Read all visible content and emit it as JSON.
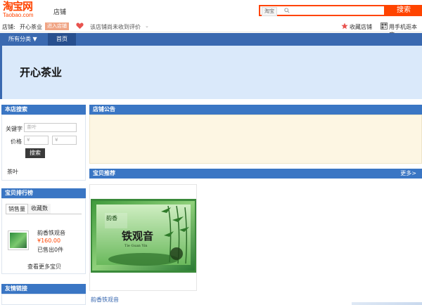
{
  "header": {
    "logo_cn": "淘宝网",
    "logo_en": "Taobao.com",
    "shop_nav": "店铺",
    "search_scope": "淘宝",
    "search_placeholder": "",
    "search_button": "搜索",
    "accent_color": "#ff4400"
  },
  "shop_info": {
    "label": "店铺:",
    "shop_name": "开心茶业",
    "enter_button": "进入店铺",
    "rating_text": "该店铺尚未收到评价",
    "rating_caret": "⌄",
    "favorite_label": "收藏店铺",
    "mobile_label": "用手机逛本店"
  },
  "nav": {
    "all_categories": "所有分类 ▼",
    "home": "首页",
    "bar_color": "#3a69b0"
  },
  "banner": {
    "title": "开心茶业",
    "background": "#dae9fa"
  },
  "search_panel": {
    "title": "本店搜索",
    "keyword_label": "关键字",
    "keyword_value": "茶叶",
    "price_label": "价格",
    "price_min_placeholder": "¥",
    "price_max_placeholder": "¥",
    "submit_label": "搜索",
    "tag": "茶叶"
  },
  "ranking_panel": {
    "title": "宝贝排行榜",
    "tabs": [
      "销售量",
      "收藏数"
    ],
    "active_tab": "销售量",
    "item": {
      "name": "韵香铁观音",
      "price": "¥160.00",
      "sold": "已售出0件"
    },
    "more_label": "查看更多宝贝"
  },
  "links_panel": {
    "title": "友情链接"
  },
  "notice_panel": {
    "title": "店铺公告",
    "background": "#fdf6e3"
  },
  "recommend_panel": {
    "title": "宝贝推荐",
    "more_label": "更多>",
    "product": {
      "name": "韵香铁观音",
      "box_text_left": "韵香",
      "box_text_main": "铁观音",
      "box_text_en": "Tie Guan Yin"
    }
  }
}
